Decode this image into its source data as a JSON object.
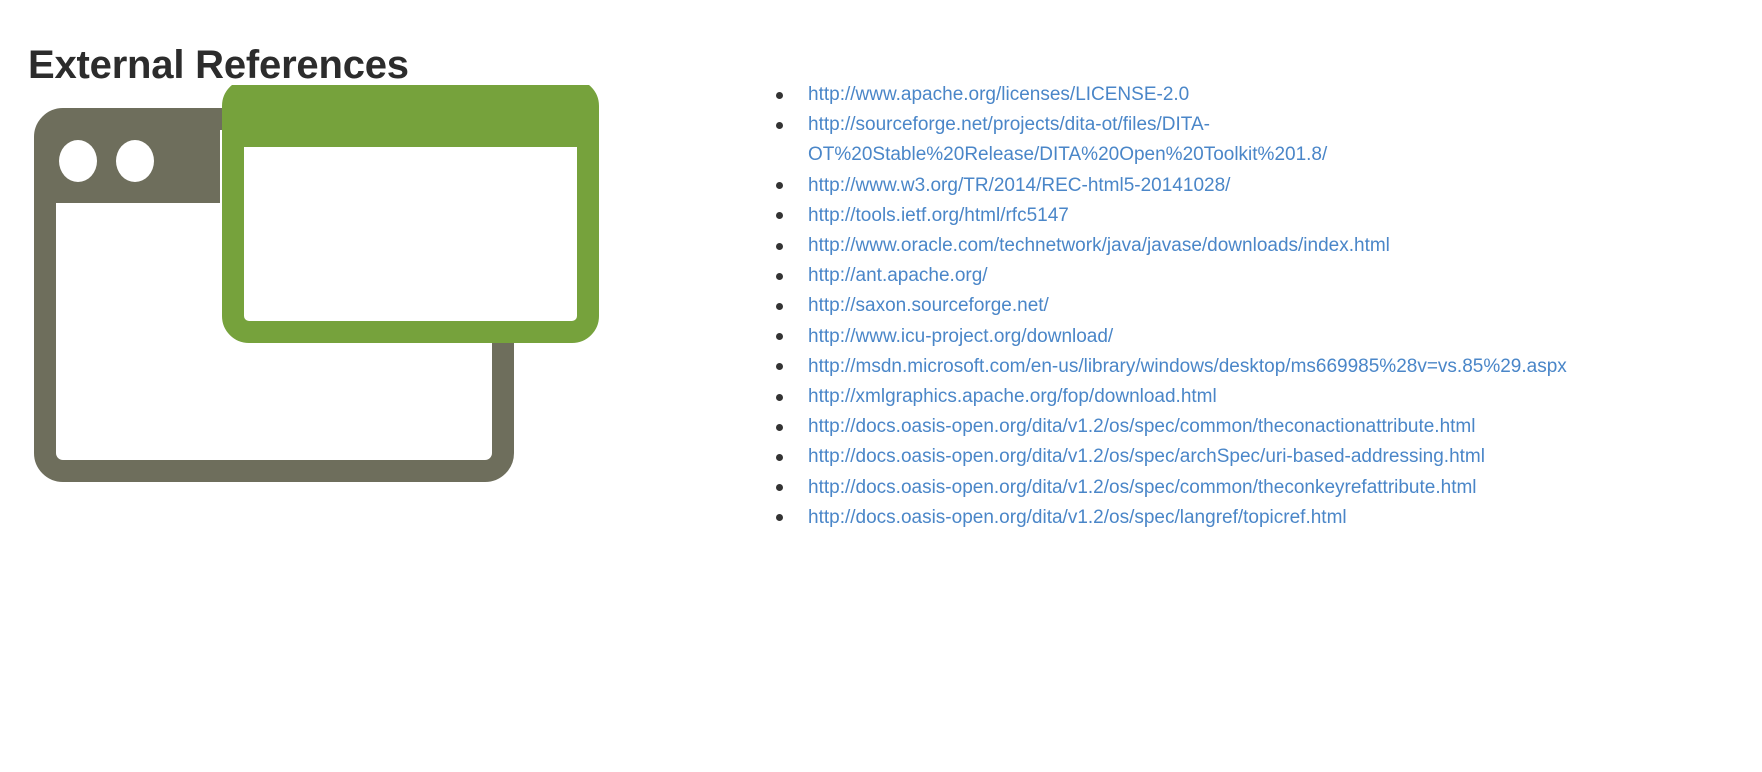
{
  "page": {
    "title": "External References",
    "background_color": "#ffffff",
    "title_color": "#2c2c2c"
  },
  "illustration": {
    "name": "external-links-browser-windows-icon",
    "back_window_color": "#6e6e5c",
    "front_window_color": "#76a23c",
    "window_fill": "#ffffff",
    "dot_color": "#ffffff",
    "dot_count": 2
  },
  "references": {
    "bullet_color": "#333333",
    "link_color": "#4a86c8",
    "items": [
      {
        "url": "http://www.apache.org/licenses/LICENSE-2.0"
      },
      {
        "url": "http://sourceforge.net/projects/dita-ot/files/DITA-OT%20Stable%20Release/DITA%20Open%20Toolkit%201.8/"
      },
      {
        "url": "http://www.w3.org/TR/2014/REC-html5-20141028/"
      },
      {
        "url": "http://tools.ietf.org/html/rfc5147"
      },
      {
        "url": "http://www.oracle.com/technetwork/java/javase/downloads/index.html"
      },
      {
        "url": "http://ant.apache.org/"
      },
      {
        "url": "http://saxon.sourceforge.net/"
      },
      {
        "url": "http://www.icu-project.org/download/"
      },
      {
        "url": "http://msdn.microsoft.com/en-us/library/windows/desktop/ms669985%28v=vs.85%29.aspx"
      },
      {
        "url": "http://xmlgraphics.apache.org/fop/download.html"
      },
      {
        "url": "http://docs.oasis-open.org/dita/v1.2/os/spec/common/theconactionattribute.html"
      },
      {
        "url": "http://docs.oasis-open.org/dita/v1.2/os/spec/archSpec/uri-based-addressing.html"
      },
      {
        "url": "http://docs.oasis-open.org/dita/v1.2/os/spec/common/theconkeyrefattribute.html"
      },
      {
        "url": "http://docs.oasis-open.org/dita/v1.2/os/spec/langref/topicref.html"
      }
    ]
  }
}
